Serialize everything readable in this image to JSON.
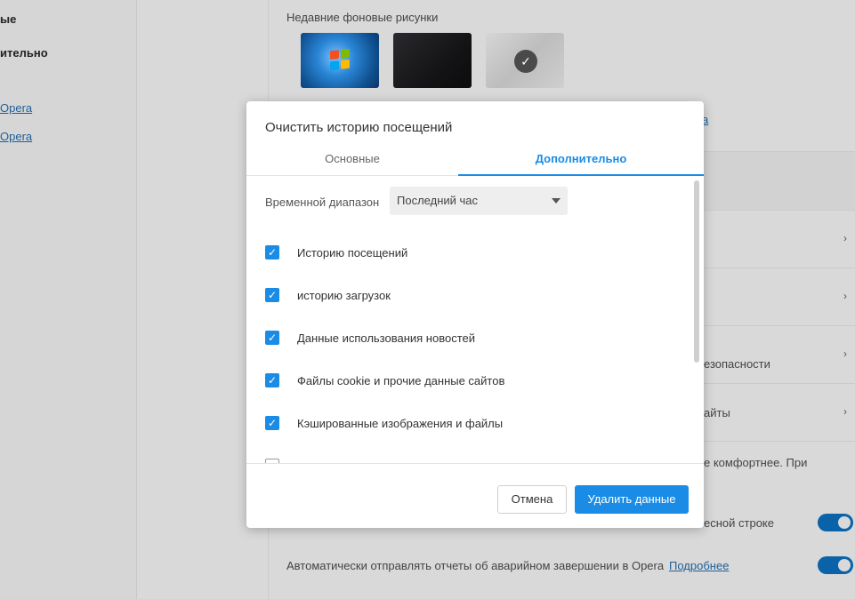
{
  "left_nav": {
    "item1": "ые",
    "item2": "ительно",
    "link1": "Opera",
    "link2": "Opera"
  },
  "background": {
    "recent_wallpapers_label": "Недавние фоновые рисунки",
    "fragment_link": "а",
    "row_security_text": "езопасности",
    "row_sites_text": "айты",
    "row_comfort_text": "е комфортнее. При",
    "row_addressbar_text": "есной строке",
    "crash_report_text": "Автоматически отправлять отчеты об аварийном завершении в Opera",
    "crash_report_link": "Подробнее"
  },
  "dialog": {
    "title": "Очистить историю посещений",
    "tabs": {
      "basic": "Основные",
      "advanced": "Дополнительно"
    },
    "time_range_label": "Временной диапазон",
    "time_range_value": "Последний час",
    "checkboxes": [
      {
        "label": "Историю посещений",
        "checked": true
      },
      {
        "label": "историю загрузок",
        "checked": true
      },
      {
        "label": "Данные использования новостей",
        "checked": true
      },
      {
        "label": "Файлы cookie и прочие данные сайтов",
        "checked": true
      },
      {
        "label": "Кэшированные изображения и файлы",
        "checked": true
      },
      {
        "label": "",
        "checked": false
      }
    ],
    "cancel_label": "Отмена",
    "delete_label": "Удалить данные"
  },
  "colors": {
    "accent": "#1a8ce5",
    "toggle_on": "#0a63a8"
  }
}
